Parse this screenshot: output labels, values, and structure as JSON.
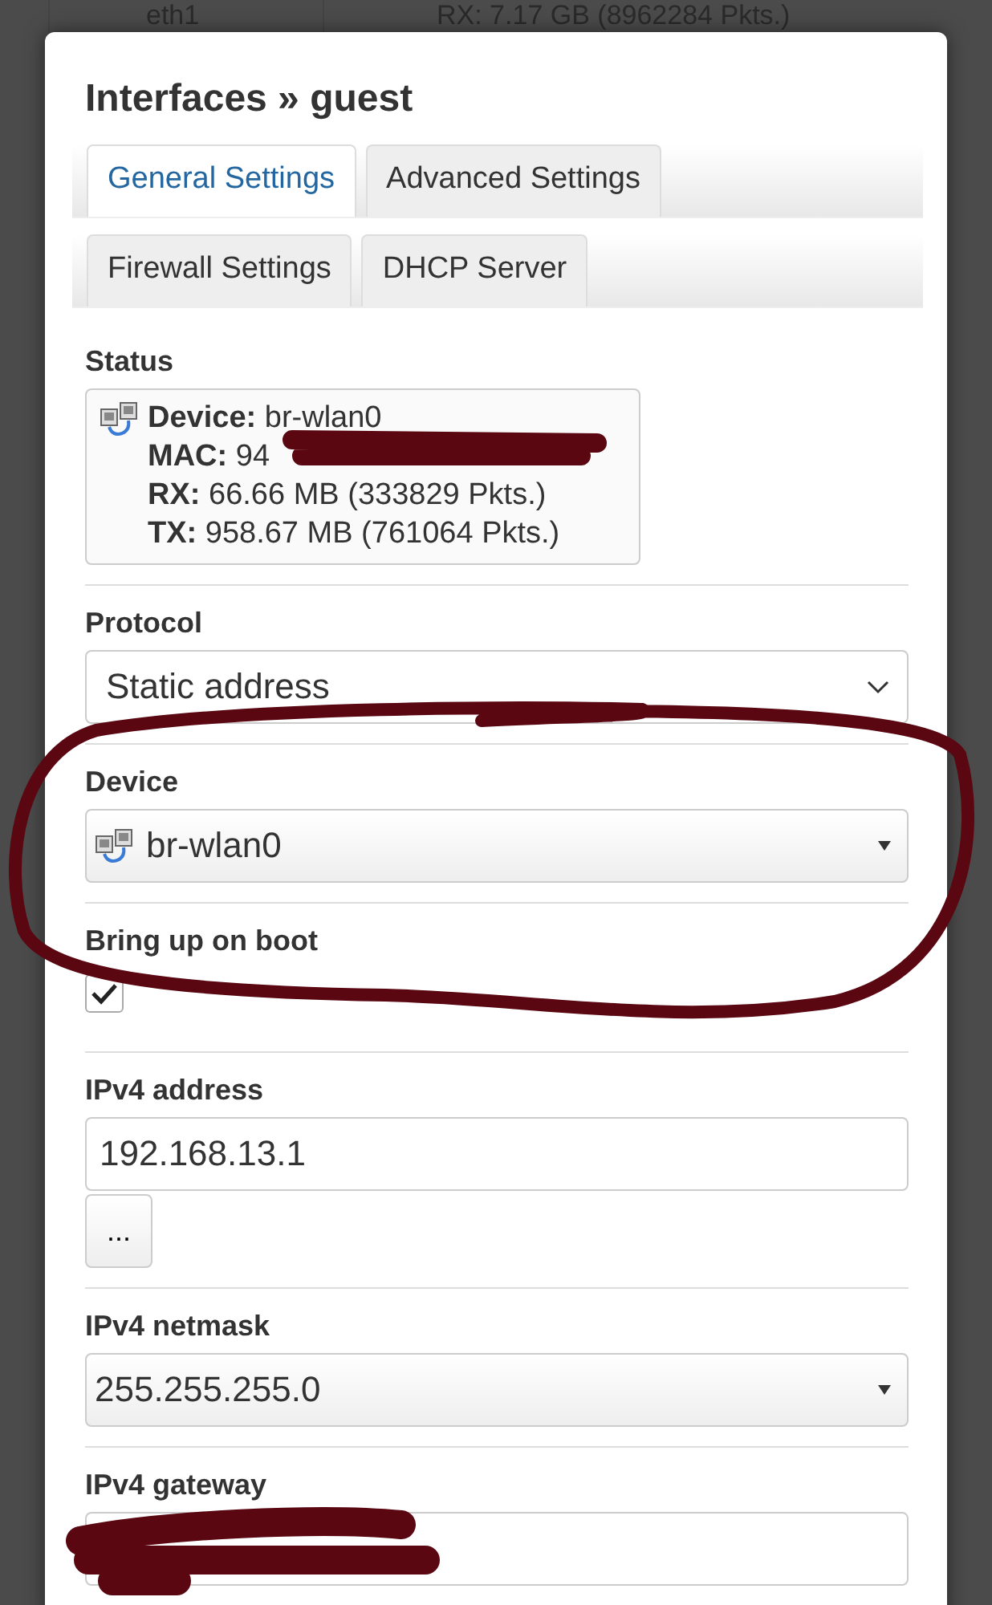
{
  "background": {
    "device_label": "eth1",
    "rx_line": "RX: 7.17 GB (8962284 Pkts.)"
  },
  "dialog": {
    "title": "Interfaces » guest",
    "tab_rows": [
      [
        {
          "label": "General Settings",
          "selected": true
        },
        {
          "label": "Advanced Settings",
          "selected": false
        }
      ],
      [
        {
          "label": "Firewall Settings",
          "selected": false
        },
        {
          "label": "DHCP Server",
          "selected": false
        }
      ]
    ],
    "status": {
      "label": "Status",
      "lines": [
        {
          "key": "Device:",
          "value": "br-wlan0"
        },
        {
          "key": "MAC:",
          "value": "94"
        },
        {
          "key": "RX:",
          "value": "66.66 MB (333829 Pkts.)"
        },
        {
          "key": "TX:",
          "value": "958.67 MB (761064 Pkts.)"
        }
      ]
    },
    "fields": [
      {
        "kind": "select",
        "label": "Protocol",
        "value": "Static address"
      },
      {
        "kind": "dropdown",
        "label": "Device",
        "value": "br-wlan0",
        "with_icon": true
      },
      {
        "kind": "checkbox",
        "label": "Bring up on boot",
        "checked": true
      },
      {
        "kind": "text",
        "label": "IPv4 address",
        "value": "192.168.13.1",
        "extra_button": "..."
      },
      {
        "kind": "dropdown",
        "label": "IPv4 netmask",
        "value": "255.255.255.0",
        "with_icon": false
      },
      {
        "kind": "text",
        "label": "IPv4 gateway"
      }
    ]
  }
}
